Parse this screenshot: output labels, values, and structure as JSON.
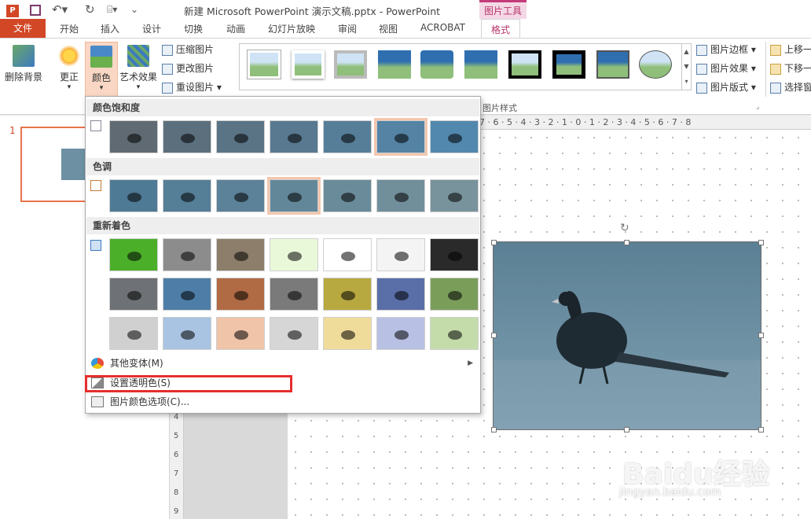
{
  "titlebar": {
    "title": "新建 Microsoft PowerPoint 演示文稿.pptx - PowerPoint",
    "context_tool": "图片工具"
  },
  "tabs": [
    "文件",
    "开始",
    "插入",
    "设计",
    "切换",
    "动画",
    "幻灯片放映",
    "审阅",
    "视图",
    "ACROBAT"
  ],
  "active_tab": "格式",
  "ribbon": {
    "remove_bg": "删除背景",
    "corrections": "更正",
    "color": "颜色",
    "artistic": "艺术效果",
    "compress": "压缩图片",
    "change": "更改图片",
    "reset": "重设图片",
    "picture_styles_group": "图片样式",
    "border": "图片边框",
    "effects": "图片效果",
    "layout": "图片版式",
    "bring_forward": "上移一",
    "send_backward": "下移一",
    "selection": "选择窗"
  },
  "slide_number": "1",
  "ruler": "7 · 6 · 5 · 4 · 3 · 2 · 1 · 0 · 1 · 2 · 3 · 4 · 5 · 6 · 7 · 8",
  "ruler_v_labels": [
    "4",
    "5",
    "6",
    "7",
    "8",
    "9"
  ],
  "dropdown": {
    "saturation": "颜色饱和度",
    "tone": "色调",
    "recolor": "重新着色",
    "more_variants": "其他变体(M)",
    "set_transparent": "设置透明色(S)",
    "color_options": "图片颜色选项(C)..."
  },
  "saturation_colors": [
    "#5f6a72",
    "#5c6f7c",
    "#5a7486",
    "#587990",
    "#567e99",
    "#5483a4",
    "#5288ae"
  ],
  "tone_colors": [
    "#4f7a96",
    "#557e97",
    "#5b8298",
    "#628799",
    "#6a8b9a",
    "#718f9b",
    "#78939c"
  ],
  "recolor_rows": [
    [
      "#4caf2a",
      "#8c8c8c",
      "#8c7e6a",
      "#eaf8da",
      "#ffffff",
      "#f4f4f4",
      "#2a2a2a"
    ],
    [
      "#6e7175",
      "#4e7ea8",
      "#b06a44",
      "#7a7a7a",
      "#b8a840",
      "#5a6ea8",
      "#7a9e5a"
    ],
    [
      "#d0d0d0",
      "#a9c4e2",
      "#f0c4a8",
      "#d6d6d6",
      "#f0dc9a",
      "#b8c0e4",
      "#c4dcaa"
    ]
  ],
  "colors": {
    "accent": "#d24726",
    "context": "#c33c7a",
    "highlight_box": "#e62e2e",
    "selected_swatch": "#f3c6ad"
  },
  "watermark": {
    "main": "Baidu经验",
    "sub": "jingyan.baidu.com"
  }
}
